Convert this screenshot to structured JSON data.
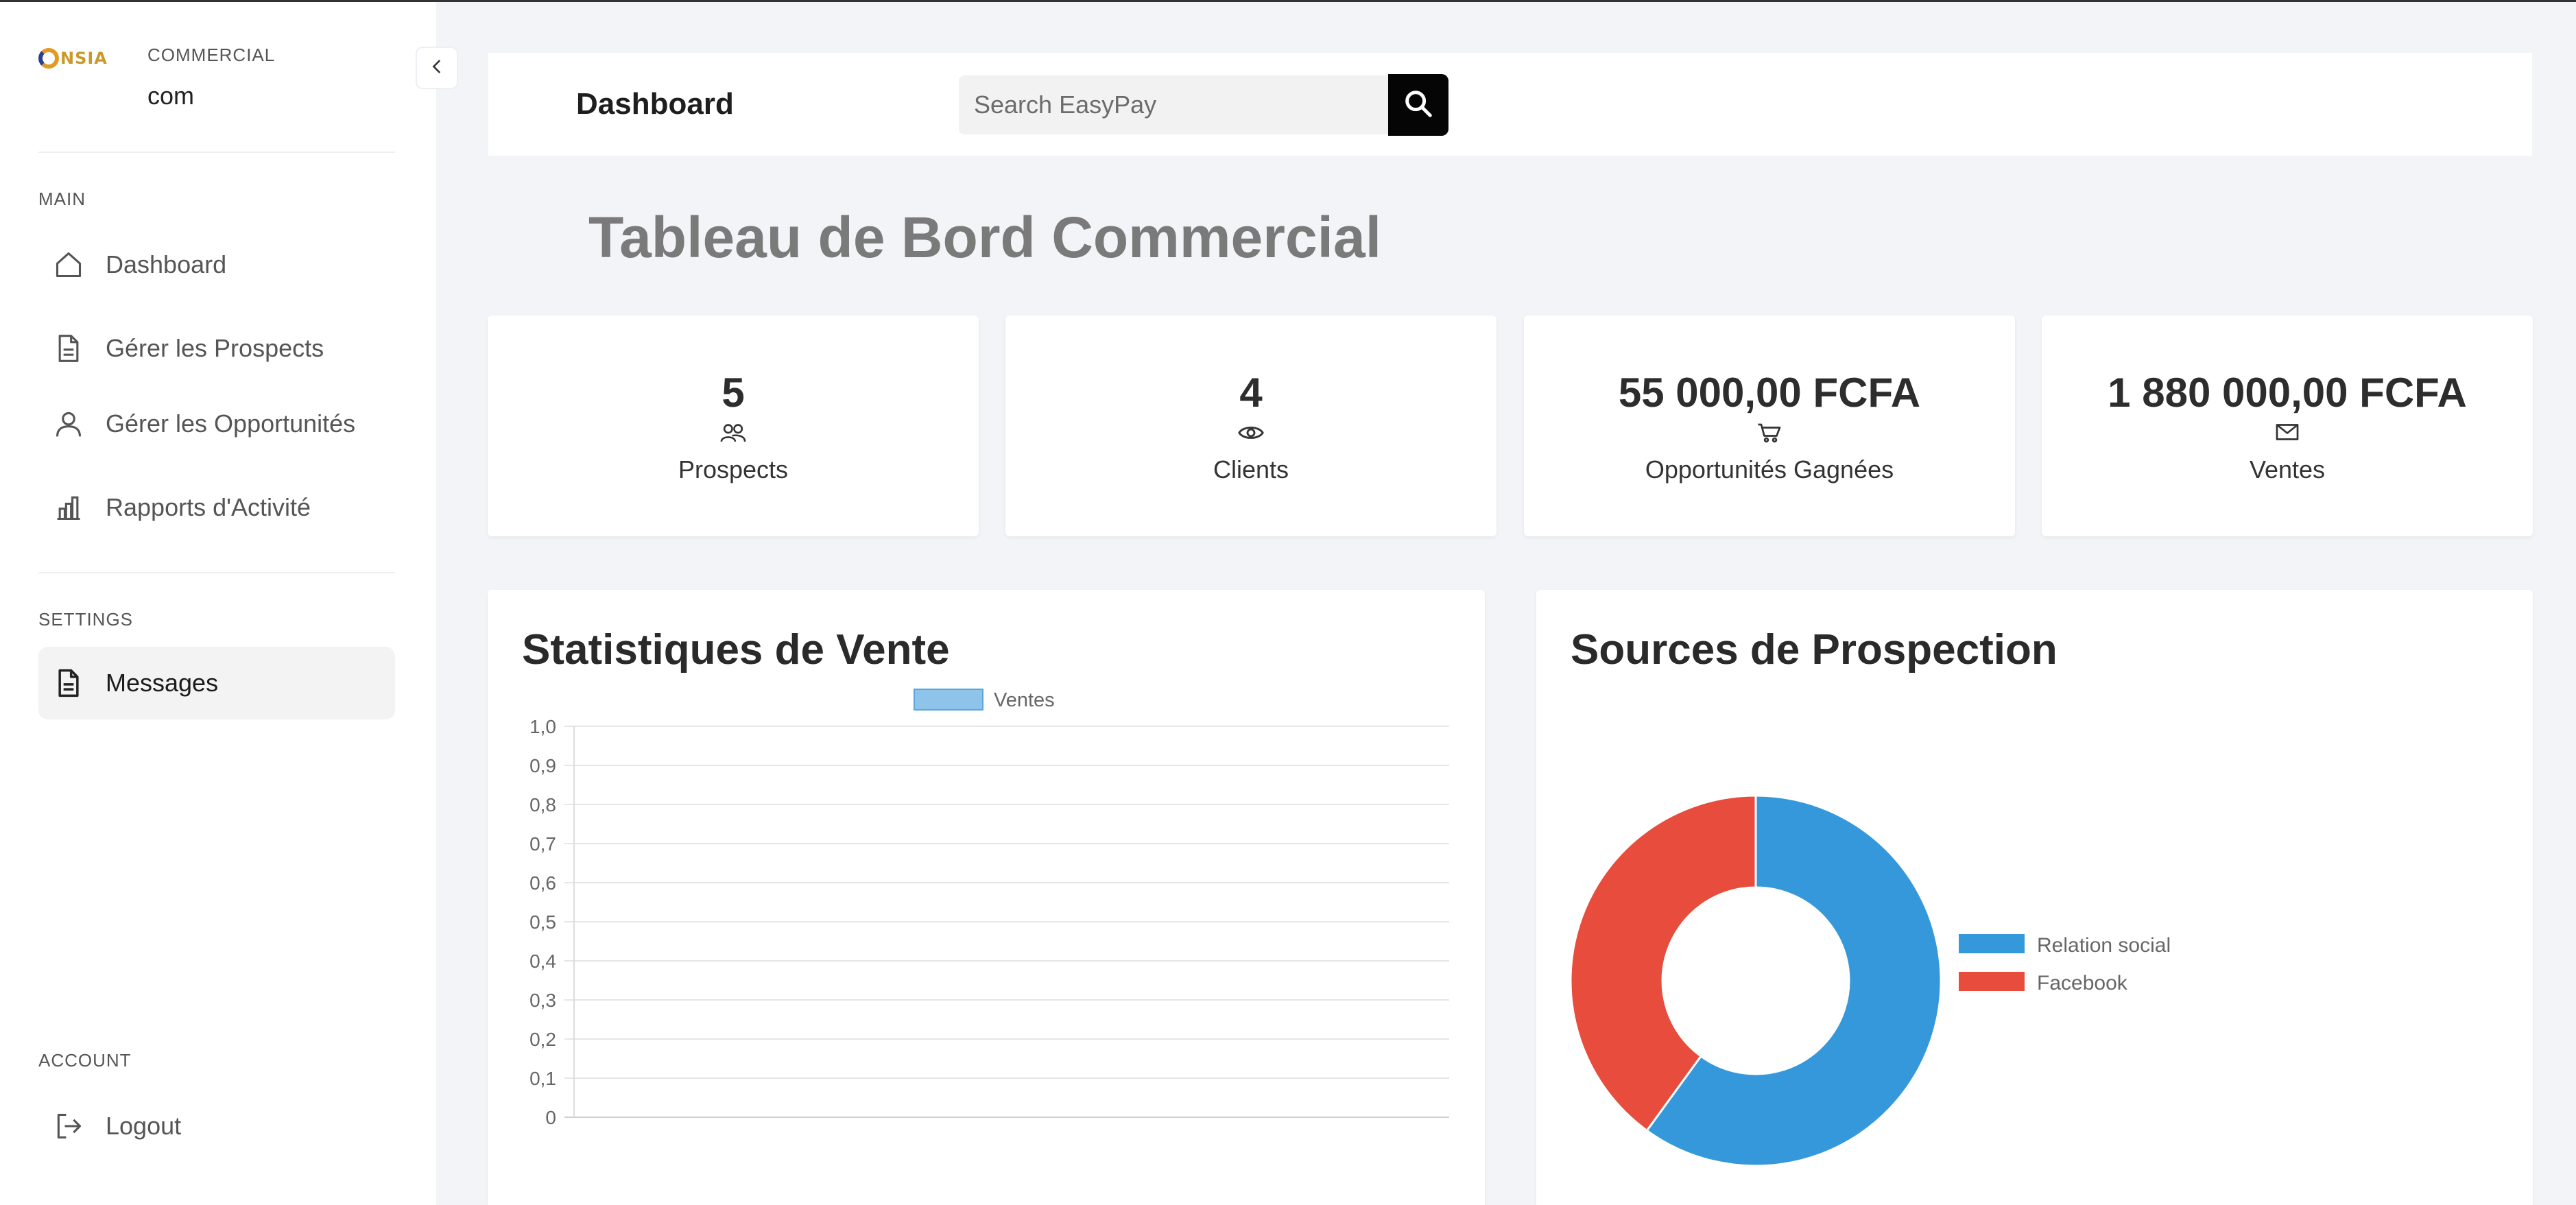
{
  "sidebar": {
    "logo_text": "NSIA",
    "role": "COMMERCIAL",
    "username": "com",
    "main_label": "MAIN",
    "settings_label": "SETTINGS",
    "account_label": "ACCOUNT",
    "items": [
      {
        "label": "Dashboard",
        "icon": "home-icon"
      },
      {
        "label": "Gérer les Prospects",
        "icon": "document-icon"
      },
      {
        "label": "Gérer les Opportunités",
        "icon": "user-icon"
      },
      {
        "label": "Rapports d'Activité",
        "icon": "bar-chart-icon"
      }
    ],
    "settings_items": [
      {
        "label": "Messages",
        "icon": "document-icon",
        "active": true
      }
    ],
    "account_items": [
      {
        "label": "Logout",
        "icon": "logout-icon"
      }
    ]
  },
  "header": {
    "title": "Dashboard",
    "search_placeholder": "Search EasyPay"
  },
  "page_title": "Tableau de Bord Commercial",
  "stats": [
    {
      "value": "5",
      "label": "Prospects",
      "icon": "users-icon"
    },
    {
      "value": "4",
      "label": "Clients",
      "icon": "eye-icon"
    },
    {
      "value": "55 000,00 FCFA",
      "label": "Opportunités Gagnées",
      "icon": "cart-icon"
    },
    {
      "value": "1 880 000,00 FCFA",
      "label": "Ventes",
      "icon": "mail-icon"
    }
  ],
  "sales_panel": {
    "title": "Statistiques de Vente"
  },
  "sources_panel": {
    "title": "Sources de Prospection"
  },
  "colors": {
    "accent": "#050505",
    "series_blue": "#3498db",
    "series_red": "#e74c3c",
    "bar_fill": "#8ec3ea"
  },
  "chart_data": [
    {
      "type": "bar",
      "title": "Statistiques de Vente",
      "series": [
        {
          "name": "Ventes",
          "values": []
        }
      ],
      "categories": [],
      "ylim": [
        0,
        1
      ],
      "yticks": [
        "0",
        "0,1",
        "0,2",
        "0,3",
        "0,4",
        "0,5",
        "0,6",
        "0,7",
        "0,8",
        "0,9",
        "1,0"
      ],
      "grid": true,
      "legend": "top"
    },
    {
      "type": "pie",
      "title": "Sources de Prospection",
      "labels": [
        "Relation social",
        "Facebook"
      ],
      "values": [
        3,
        2
      ],
      "colors": [
        "#3498db",
        "#e74c3c"
      ],
      "legend": "right"
    }
  ]
}
